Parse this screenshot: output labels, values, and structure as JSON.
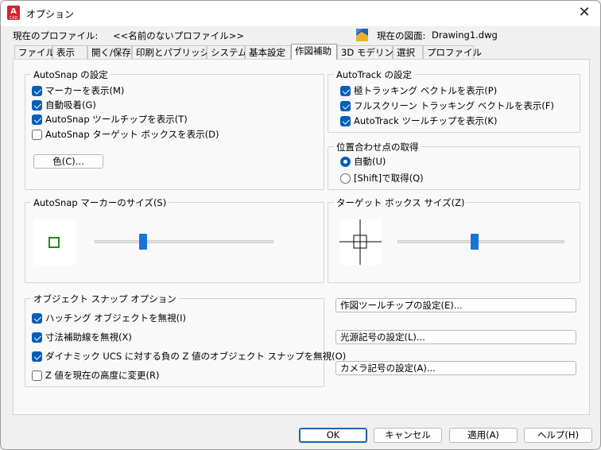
{
  "window": {
    "title": "オプション",
    "app_icon_letter": "A",
    "app_icon_sub": "CAD",
    "close_glyph": "✕"
  },
  "profile": {
    "label": "現在のプロファイル:",
    "value": "<<名前のないプロファイル>>",
    "drawing_label": "現在の図面:",
    "drawing_value": "Drawing1.dwg"
  },
  "tabs": [
    {
      "label": "ファイル",
      "active": false
    },
    {
      "label": "表示",
      "active": false
    },
    {
      "label": "開く/保存",
      "active": false
    },
    {
      "label": "印刷とパブリッシュ",
      "active": false
    },
    {
      "label": "システム",
      "active": false
    },
    {
      "label": "基本設定",
      "active": false
    },
    {
      "label": "作図補助",
      "active": true
    },
    {
      "label": "3D モデリング",
      "active": false
    },
    {
      "label": "選択",
      "active": false
    },
    {
      "label": "プロファイル",
      "active": false
    }
  ],
  "autosnap": {
    "title": "AutoSnap の設定",
    "items": [
      {
        "label": "マーカーを表示(M)",
        "checked": true
      },
      {
        "label": "自動吸着(G)",
        "checked": true
      },
      {
        "label": "AutoSnap ツールチップを表示(T)",
        "checked": true
      },
      {
        "label": "AutoSnap ターゲット ボックスを表示(D)",
        "checked": false
      }
    ],
    "color_button": "色(C)..."
  },
  "autotrack": {
    "title": "AutoTrack の設定",
    "items": [
      {
        "label": "極トラッキング ベクトルを表示(P)",
        "checked": true
      },
      {
        "label": "フルスクリーン トラッキング ベクトルを表示(F)",
        "checked": true
      },
      {
        "label": "AutoTrack ツールチップを表示(K)",
        "checked": true
      }
    ]
  },
  "alignment": {
    "title": "位置合わせ点の取得",
    "options": [
      {
        "label": "自動(U)",
        "selected": true
      },
      {
        "label": "[Shift]で取得(Q)",
        "selected": false
      }
    ]
  },
  "marker_size": {
    "title": "AutoSnap マーカーのサイズ(S)",
    "value_fraction": 0.27,
    "marker_color": "#1a8a1a"
  },
  "target_size": {
    "title": "ターゲット ボックス サイズ(Z)",
    "value_fraction": 0.46
  },
  "osnap": {
    "title": "オブジェクト スナップ オプション",
    "items": [
      {
        "label": "ハッチング オブジェクトを無視(I)",
        "checked": true
      },
      {
        "label": "寸法補助線を無視(X)",
        "checked": true
      },
      {
        "label": "ダイナミック UCS に対する負の Z 値のオブジェクト スナップを無視(O)",
        "checked": true
      },
      {
        "label": "Z 値を現在の高度に変更(R)",
        "checked": false
      }
    ]
  },
  "right_buttons": {
    "drafting_tooltip": "作図ツールチップの設定(E)...",
    "light_glyph": "光源記号の設定(L)...",
    "camera_glyph": "カメラ記号の設定(A)..."
  },
  "footer": {
    "ok": "OK",
    "cancel": "キャンセル",
    "apply": "適用(A)",
    "help": "ヘルプ(H)"
  },
  "colors": {
    "accent": "#005fb8",
    "slider_thumb": "#1a73d8"
  }
}
